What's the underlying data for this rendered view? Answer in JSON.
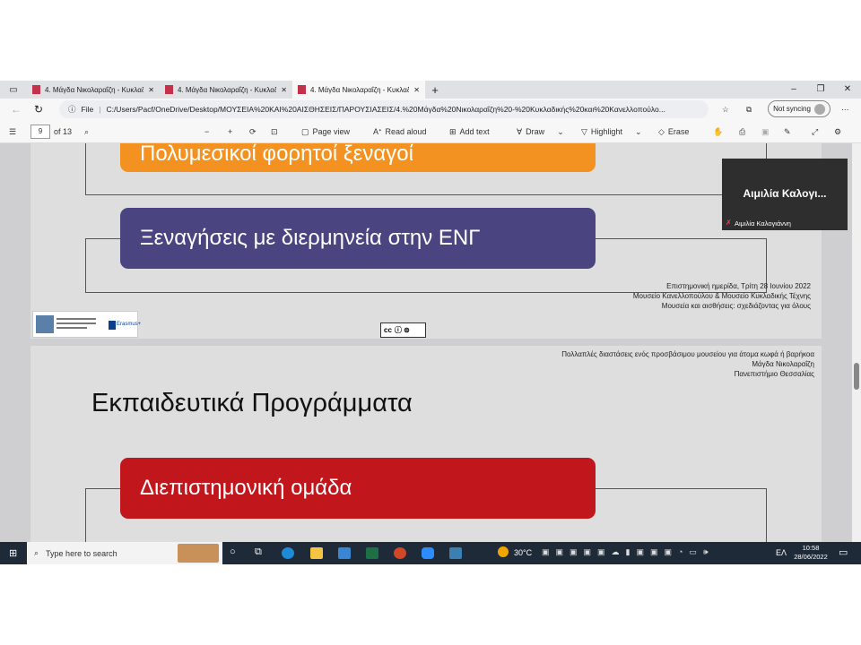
{
  "browser": {
    "tabs": [
      {
        "title": "4. Μάγδα Νικολαραΐζη - Κυκλαδ"
      },
      {
        "title": "4. Μάγδα Νικολαραΐζη - Κυκλαδ"
      },
      {
        "title": "4. Μάγδα Νικολαραΐζη - Κυκλαδ"
      }
    ],
    "new_tab": "+",
    "file_label": "File",
    "url": "C:/Users/Pacf/OneDrive/Desktop/ΜΟΥΣΕΙΑ%20ΚΑΙ%20ΑΙΣΘΗΣΕΙΣ/ΠΑΡΟΥΣΙΑΣΕΙΣ/4.%20Μάγδα%20Νικολαραΐζη%20-%20Κυκλαδικής%20και%20Κανελλοπούλο...",
    "sync_label": "Not syncing"
  },
  "pdf_toolbar": {
    "page_current": "9",
    "page_total": "of 13",
    "page_view": "Page view",
    "read_aloud": "Read aloud",
    "add_text": "Add text",
    "draw": "Draw",
    "highlight": "Highlight",
    "erase": "Erase"
  },
  "slide1": {
    "orange_button": "Πολυμεσικοί φορητοί ξεναγοί",
    "purple_button": "Ξεναγήσεις με διερμηνεία στην ΕΝΓ",
    "footer_lines": [
      "Επιστημονική ημερίδα, Τρίτη 28 Ιουνίου 2022",
      "Μουσείο Κανελλοπούλου & Μουσείο Κυκλαδικής Τέχνης",
      "Μουσεία και αισθήσεις: σχεδιάζοντας για όλους"
    ],
    "erasmus": "Erasmus+",
    "cc": "cc"
  },
  "slide2": {
    "header_lines": [
      "Πολλαπλές διαστάσεις ενός προσβάσιμου μουσείου για άτομα κωφά ή βαρήκοα",
      "Μάγδα Νικολαραΐζη",
      "Πανεπιστήμιο Θεσσαλίας"
    ],
    "title": "Εκπαιδευτικά Προγράμματα",
    "red_button": "Διεπιστημονική ομάδα"
  },
  "video": {
    "name_large": "Αιμιλία Καλογι...",
    "name_small": "Αιμιλία Καλογιάννη"
  },
  "taskbar": {
    "search_placeholder": "Type here to search",
    "temperature": "30°C",
    "lang": "ΕΛ",
    "time": "10:58",
    "date": "28/06/2022"
  },
  "colors": {
    "orange": "#f39220",
    "purple": "#4a4580",
    "red": "#c1161c"
  }
}
